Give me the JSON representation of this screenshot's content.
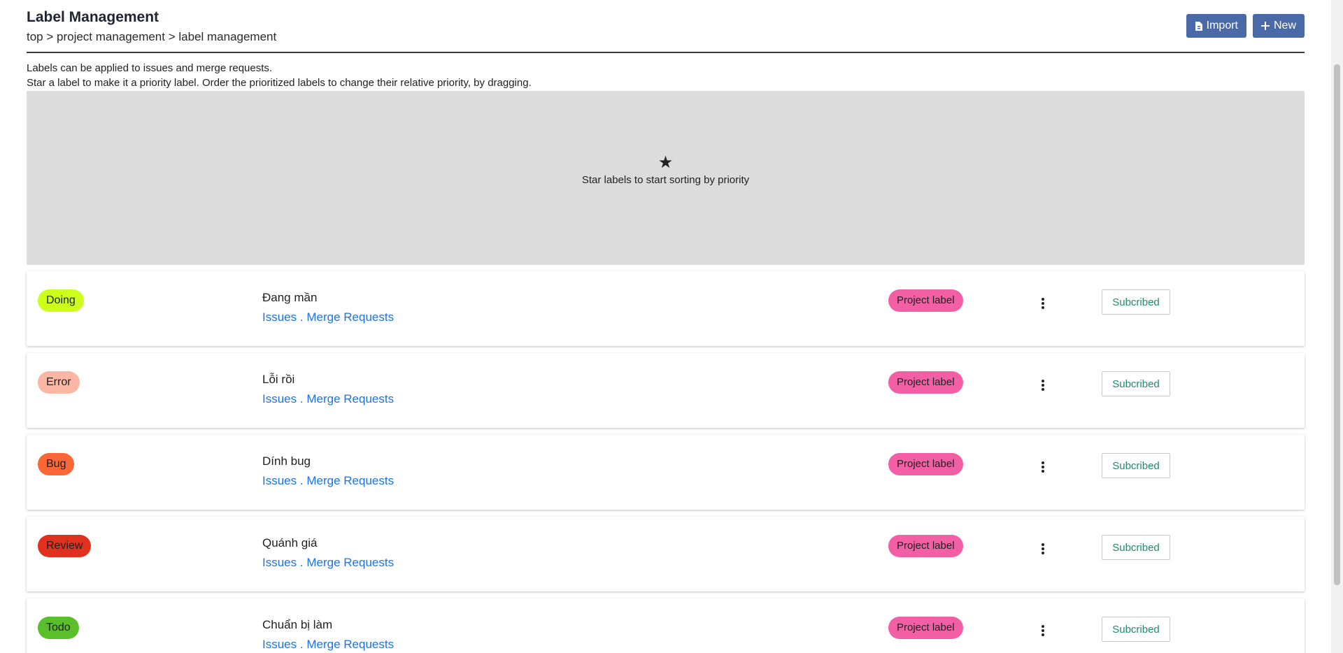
{
  "header": {
    "title": "Label Management",
    "breadcrumb": "top > project management > label management",
    "import_label": "Import",
    "new_label": "New"
  },
  "description": {
    "line1": "Labels can be applied to issues and merge requests.",
    "line2": "Star a label to make it a priority label. Order the prioritized labels to change their relative priority, by dragging."
  },
  "priority": {
    "hint": "Star labels to start sorting by priority",
    "icon": "star-icon"
  },
  "labels": [
    {
      "name": "Doing",
      "color": "#ccff1a",
      "description": "Đang mần",
      "issues": "Issues",
      "sep": ".",
      "merge": "Merge Requests",
      "badge": "Project label",
      "subscribe": "Subcribed"
    },
    {
      "name": "Error",
      "color": "#fbb6a4",
      "description": "Lỗi rồi",
      "issues": "Issues",
      "sep": ".",
      "merge": "Merge Requests",
      "badge": "Project label",
      "subscribe": "Subcribed"
    },
    {
      "name": "Bug",
      "color": "#fb6736",
      "description": "Dính bug",
      "issues": "Issues",
      "sep": ".",
      "merge": "Merge Requests",
      "badge": "Project label",
      "subscribe": "Subcribed"
    },
    {
      "name": "Review",
      "color": "#e0301e",
      "description": "Quánh giá",
      "issues": "Issues",
      "sep": ".",
      "merge": "Merge Requests",
      "badge": "Project label",
      "subscribe": "Subcribed"
    },
    {
      "name": "Todo",
      "color": "#5bbf2c",
      "description": "Chuẩn bị làm",
      "issues": "Issues",
      "sep": ".",
      "merge": "Merge Requests",
      "badge": "Project label",
      "subscribe": "Subcribed"
    }
  ],
  "colors": {
    "primary_button": "#4a6aa7",
    "project_badge": "#f35fa4",
    "link": "#1a73e8",
    "subscribed_text": "#23886d"
  }
}
